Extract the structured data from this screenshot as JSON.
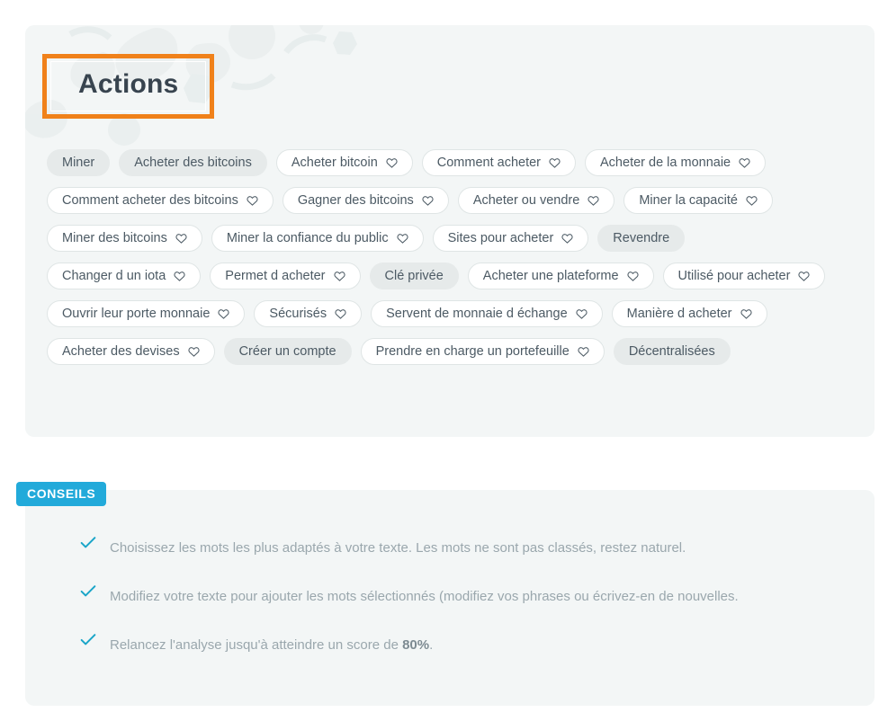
{
  "actions_panel": {
    "title": "Actions",
    "title_highlight_color": "#f0811a",
    "panel_color": "#f3f6f6",
    "watermark": "gears-map-watermark",
    "tags": [
      {
        "label": "Miner",
        "selectable": false
      },
      {
        "label": "Acheter des bitcoins",
        "selectable": false
      },
      {
        "label": "Acheter bitcoin",
        "selectable": true
      },
      {
        "label": "Comment acheter",
        "selectable": true
      },
      {
        "label": "Acheter de la monnaie",
        "selectable": true
      },
      {
        "label": "Comment acheter des bitcoins",
        "selectable": true
      },
      {
        "label": "Gagner des bitcoins",
        "selectable": true
      },
      {
        "label": "Acheter ou vendre",
        "selectable": true
      },
      {
        "label": "Miner la capacité",
        "selectable": true
      },
      {
        "label": "Miner des bitcoins",
        "selectable": true
      },
      {
        "label": "Miner la confiance du public",
        "selectable": true
      },
      {
        "label": "Sites pour acheter",
        "selectable": true
      },
      {
        "label": "Revendre",
        "selectable": false
      },
      {
        "label": "Changer d un iota",
        "selectable": true
      },
      {
        "label": "Permet d acheter",
        "selectable": true
      },
      {
        "label": "Clé privée",
        "selectable": false
      },
      {
        "label": "Acheter une plateforme",
        "selectable": true
      },
      {
        "label": "Utilisé pour acheter",
        "selectable": true
      },
      {
        "label": "Ouvrir leur porte monnaie",
        "selectable": true
      },
      {
        "label": "Sécurisés",
        "selectable": true
      },
      {
        "label": "Servent de monnaie d échange",
        "selectable": true
      },
      {
        "label": "Manière d acheter",
        "selectable": true
      },
      {
        "label": "Acheter des devises",
        "selectable": true
      },
      {
        "label": "Créer un compte",
        "selectable": false
      },
      {
        "label": "Prendre en charge un portefeuille",
        "selectable": true
      },
      {
        "label": "Décentralisées",
        "selectable": false
      }
    ],
    "heart_icon": "heart-outline-icon"
  },
  "conseils_panel": {
    "badge_label": "CONSEILS",
    "badge_color": "#22aada",
    "check_icon": "check-icon",
    "check_color": "#1aa5c8",
    "tips": [
      {
        "before": "Choisissez les mots les plus adaptés à votre texte. Les mots ne sont pas classés, restez naturel.",
        "bold": "",
        "after": ""
      },
      {
        "before": "Modifiez votre texte pour ajouter les mots sélectionnés (modifiez vos phrases ou écrivez-en de nouvelles.",
        "bold": "",
        "after": ""
      },
      {
        "before": "Relancez l'analyse jusqu'à atteindre un score de ",
        "bold": "80%",
        "after": "."
      }
    ]
  }
}
